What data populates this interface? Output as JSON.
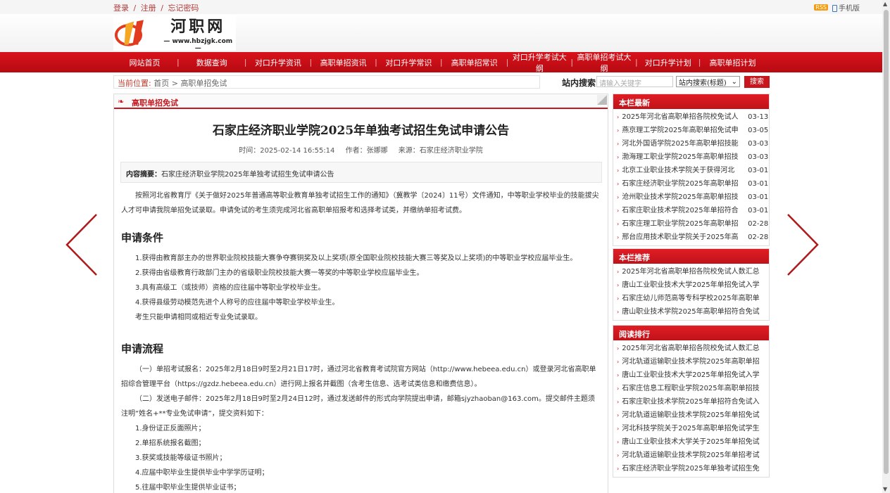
{
  "topbar": {
    "links": [
      "登录",
      "/",
      "注册",
      "/",
      "忘记密码"
    ],
    "rss": "RSS",
    "mobile": "手机版"
  },
  "logo": {
    "name": "河职网",
    "url": "— www.hbzjgk.com —"
  },
  "nav": [
    "网站首页",
    "数据查询",
    "对口升学资讯",
    "高职单招资讯",
    "对口升学常识",
    "高职单招常识",
    "对口升学考试大纲",
    "高职单招考试大纲",
    "对口升学计划",
    "高职单招计划"
  ],
  "breadcrumb": {
    "label": "当前位置:",
    "home": "首页",
    "sep": ">",
    "current": "高职单招免试"
  },
  "search": {
    "label": "站内搜索",
    "placeholder": "请输入关键字",
    "select": "站内搜索(标题)",
    "button": "搜索"
  },
  "main": {
    "section": "高职单招免试",
    "title": "石家庄经济职业学院2025年单独考试招生免试申请公告",
    "meta": {
      "time": "时间：2025-02-14 16:55:14",
      "author": "作者：张娜娜",
      "source": "来源：石家庄经济职业学院"
    },
    "summary_label": "内容摘要：",
    "summary": "石家庄经济职业学院2025年单独考试招生免试申请公告",
    "intro": "按照河北省教育厅《关于做好2025年普通高等职业教育单独考试招生工作的通知》（冀教学〔2024〕11号）文件通知，中等职业学校毕业的技能拔尖人才可申请我院单招免试录取。申请免试的考生须完成河北省高职单招报考和选择考试类，并缴纳单招考试费。",
    "h_conditions": "申请条件",
    "conditions": [
      "1.获得由教育部主办的世界职业院校技能大赛争夺赛铜奖及以上奖项(原全国职业院校技能大赛三等奖及以上奖项)的中等职业学校应届毕业生。",
      "2.获得由省级教育行政部门主办的省级职业院校技能大赛一等奖的中等职业学校应届毕业生。",
      "3.具有高级工（或技师）资格的应往届中等职业学校毕业生。",
      "4.获得县级劳动模范先进个人称号的应往届中等职业学校毕业生。",
      "考生只能申请相同或相近专业免试录取。"
    ],
    "h_process": "申请流程",
    "process1": "（一）单招考试报名：2025年2月18日9时至2月21日17时，通过河北省教育考试院官方网站（http://www.hebeea.edu.cn）或登录河北省高职单招综合管理平台（https://gzdz.hebeea.edu.cn）进行网上报名并截图（含考生信息、选考试类信息和缴费信息）。",
    "process2": "（二）发送电子邮件：2025年2月18日9时至2月24日12时，通过发送邮件的形式向学院提出申请，邮箱sjyzhaoban@163.com。提交邮件主题须注明“姓名+**专业免试申请”，提交资料如下：",
    "materials": [
      "1.身份证正反面照片；",
      "2.单招系统报名截图；",
      "3.获奖或技能等级证书照片；",
      "4.应届中职毕业生提供毕业中学学历证明；",
      "5.往届中职毕业生提供毕业证书；"
    ]
  },
  "sidebar": {
    "latest_title": "本栏最新",
    "latest": [
      {
        "t": "2025年河北省高职单招各院校免试人",
        "d": "03-13"
      },
      {
        "t": "燕京理工学院2025年高职单招免试申",
        "d": "03-05"
      },
      {
        "t": "河北外国语学院2025年高职单招技能",
        "d": "03-03"
      },
      {
        "t": "渤海理工职业学院2025年高职单招技",
        "d": "03-03"
      },
      {
        "t": "北京工业职业技术学院关于获得河北",
        "d": "03-01"
      },
      {
        "t": "石家庄经济职业学院2025年高职单招",
        "d": "03-01"
      },
      {
        "t": "沧州职业技术学院2025年高职单招技",
        "d": "03-01"
      },
      {
        "t": "石家庄职业技术学院2025年单招符合",
        "d": "03-01"
      },
      {
        "t": "石家庄理工职业学院2025年高职单招",
        "d": "02-28"
      },
      {
        "t": "邢台应用技术职业学院关于2025年高",
        "d": "02-28"
      }
    ],
    "recommend_title": "本栏推荐",
    "recommend": [
      "2025年河北省高职单招各院校免试人数汇总",
      "唐山工业职业技术大学2025年单招免试入学",
      "石家庄幼儿师范高等专科学校2025年高职单",
      "唐山职业技术学院2025年高职单招符合免试"
    ],
    "rank_title": "阅读排行",
    "rank": [
      "2025年河北省高职单招各院校免试人数汇总",
      "河北轨道运输职业技术学院2025年高职单招",
      "唐山工业职业技术大学2025年单招免试入学",
      "石家庄信息工程职业学院2025年高职单招技",
      "石家庄职业技术学院2025年单招符合免试入",
      "河北轨道运输职业技术学院2025年单招免试",
      "河北科技学院关于2025年高职单招免试学生",
      "唐山工业职业技术大学关于2025年单招免试",
      "河北轨道运输职业技术学院2025年单招考试",
      "石家庄经济职业学院2025年单独考试招生免"
    ]
  }
}
